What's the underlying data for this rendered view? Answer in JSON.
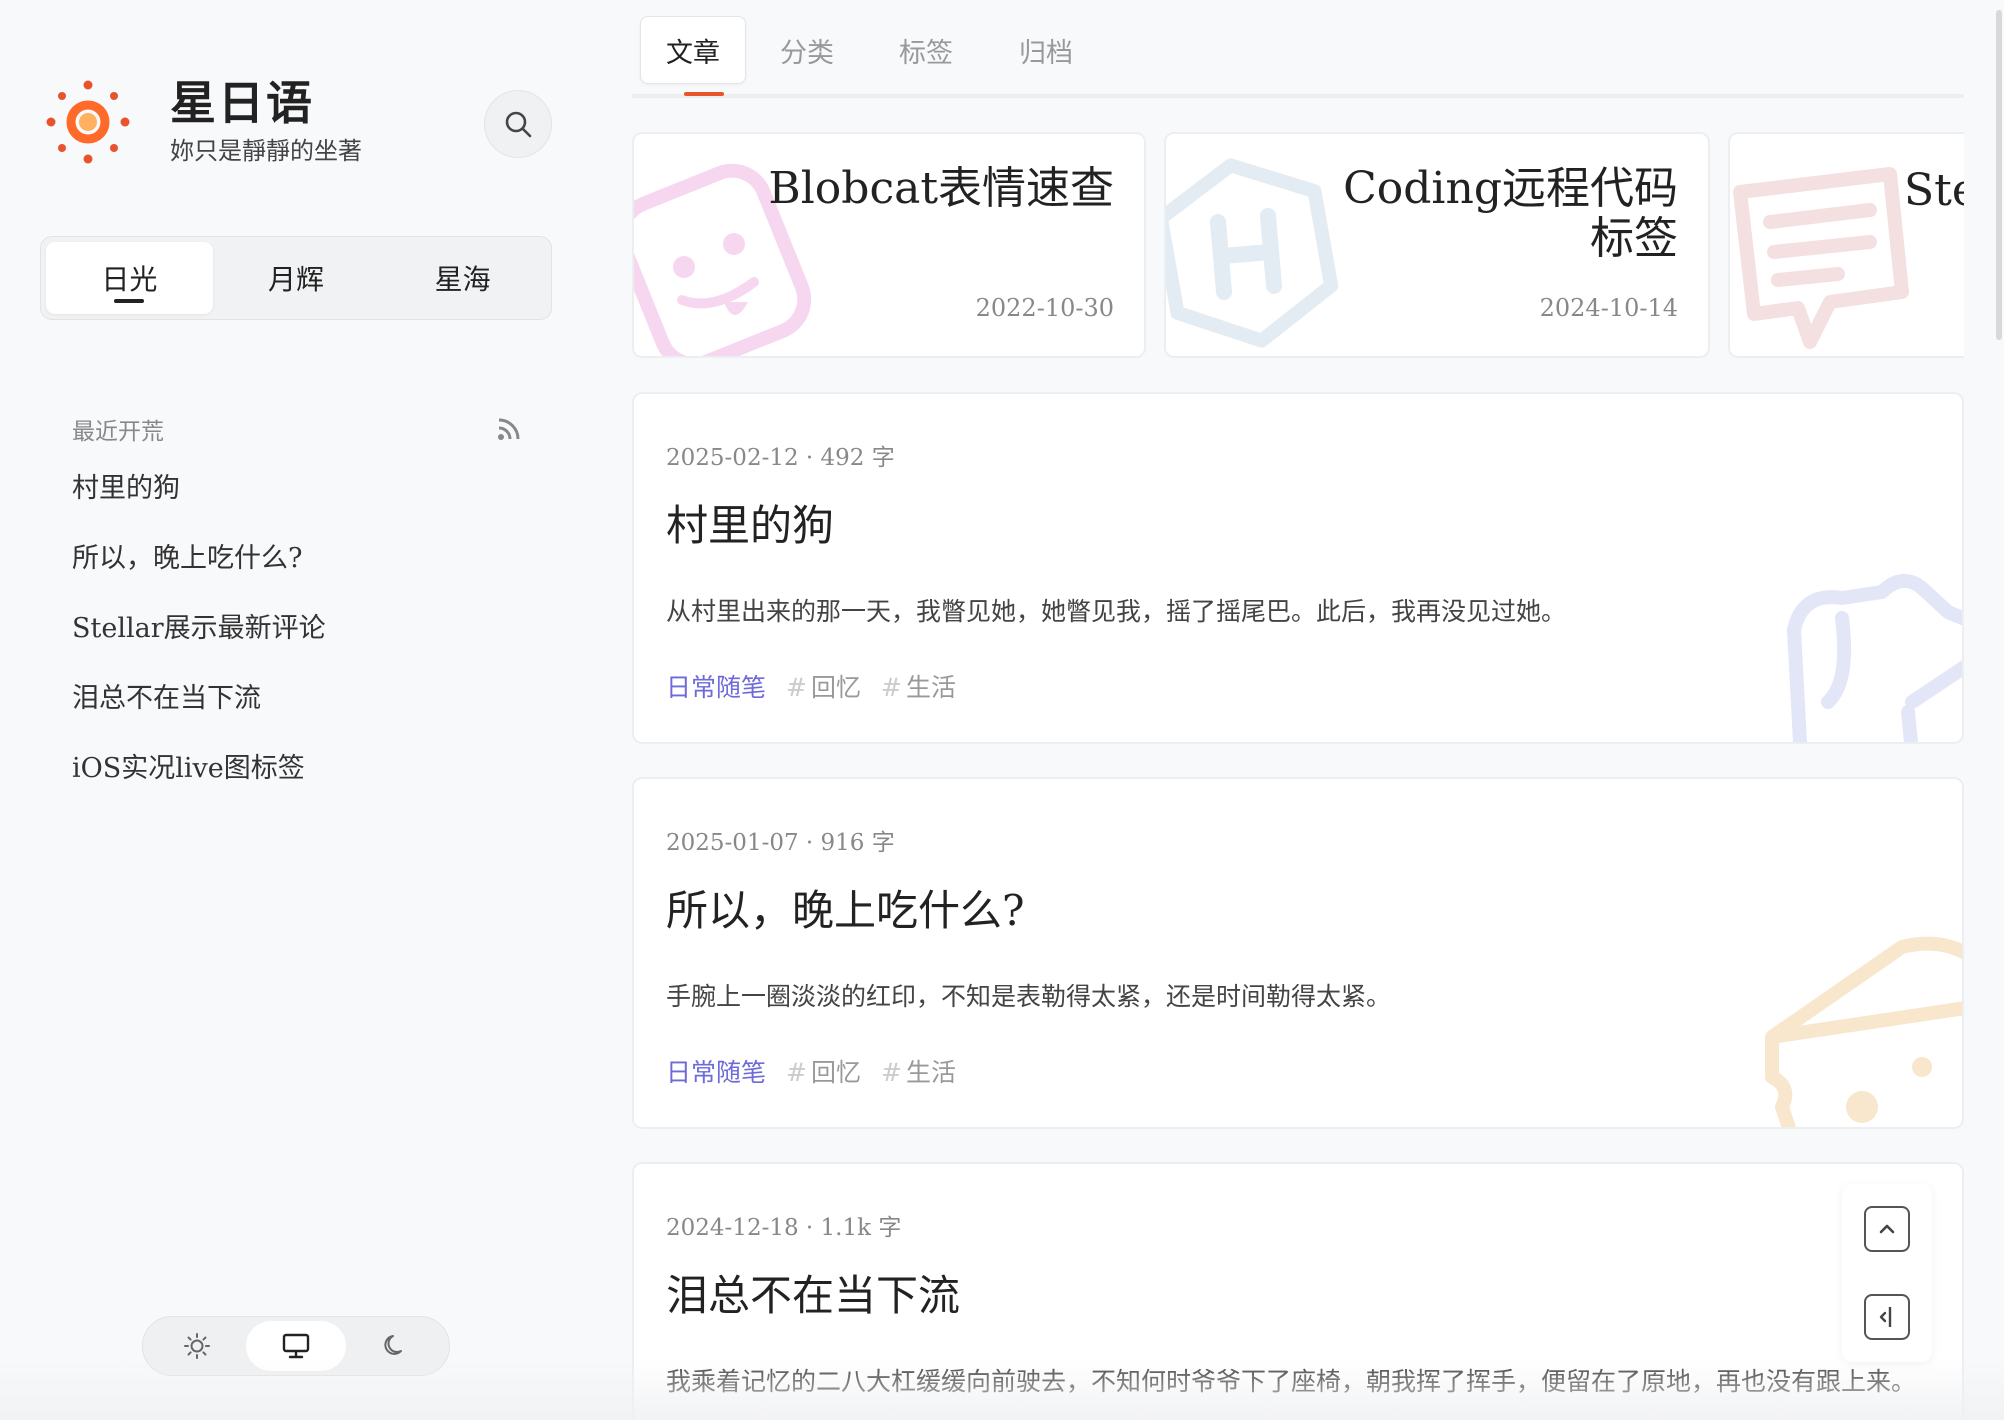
{
  "site": {
    "title": "星日语",
    "subtitle": "妳只是靜靜的坐著"
  },
  "segments": [
    {
      "label": "日光",
      "active": true
    },
    {
      "label": "月辉",
      "active": false
    },
    {
      "label": "星海",
      "active": false
    }
  ],
  "recent": {
    "label": "最近开荒",
    "items": [
      "村里的狗",
      "所以，晚上吃什么?",
      "Stellar展示最新评论",
      "泪总不在当下流",
      "iOS实况live图标签"
    ]
  },
  "tabs": [
    {
      "label": "文章",
      "active": true
    },
    {
      "label": "分类",
      "active": false
    },
    {
      "label": "标签",
      "active": false
    },
    {
      "label": "归档",
      "active": false
    }
  ],
  "topics": [
    {
      "title": "Blobcat表情速查",
      "date": "2022-10-30",
      "icon": "blobcat-face-icon",
      "color": "#f2c6ea"
    },
    {
      "title_line1": "Coding远程代码",
      "title_line2": "标签",
      "date": "2024-10-14",
      "icon": "hexagon-h-icon",
      "color": "#cfe0ea"
    },
    {
      "title": "Ste",
      "icon": "comment-bubble-icon",
      "color": "#efc9cc"
    }
  ],
  "posts": [
    {
      "meta": "2025-02-12 · 492 字",
      "title": "村里的狗",
      "excerpt": "从村里出来的那一天，我瞥见她，她瞥见我，摇了摇尾巴。此后，我再没见过她。",
      "category": "日常随笔",
      "tags": [
        "回忆",
        "生活"
      ],
      "deco_icon": "dog-icon",
      "deco_color": "#dfe3f5"
    },
    {
      "meta": "2025-01-07 · 916 字",
      "title": "所以，晚上吃什么?",
      "excerpt": "手腕上一圈淡淡的红印，不知是表勒得太紧，还是时间勒得太紧。",
      "category": "日常随笔",
      "tags": [
        "回忆",
        "生活"
      ],
      "deco_icon": "cheese-icon",
      "deco_color": "#f7e3c4"
    },
    {
      "meta": "2024-12-18 · 1.1k 字",
      "title": "泪总不在当下流",
      "excerpt": "我乘着记忆的二八大杠缓缓向前驶去，不知何时爷爷下了座椅，朝我挥了挥手，便留在了原地，再也没有跟上来。"
    }
  ],
  "colors": {
    "accent": "#e8532b",
    "category": "#6e6ad8",
    "sun": "#ff6a2a"
  }
}
